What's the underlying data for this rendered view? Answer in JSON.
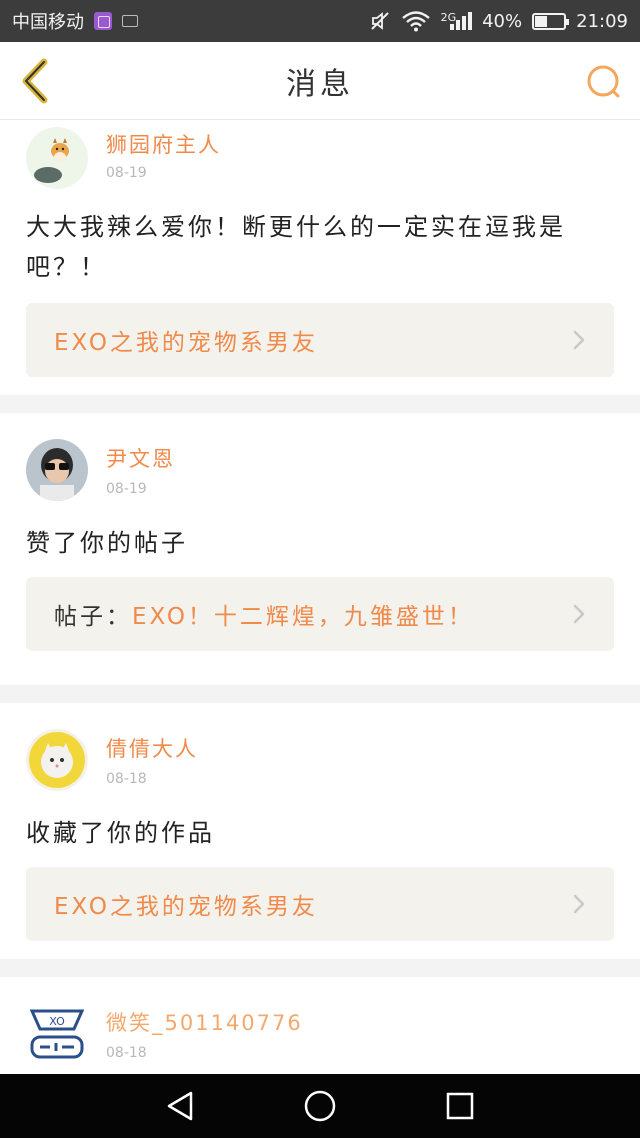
{
  "statusbar": {
    "carrier": "中国移动",
    "network": "2G",
    "battery": "40%",
    "battery_level": 0.4,
    "time": "21:09"
  },
  "header": {
    "title": "消息",
    "back_icon": "back-chevron-icon",
    "search_icon": "search-icon"
  },
  "messages": [
    {
      "username": "狮园府主人",
      "date": "08-19",
      "text": "大大我辣么爱你！断更什么的一定实在逗我是吧？！",
      "link_prefix": "",
      "link_text": "EXO之我的宠物系男友"
    },
    {
      "username": "尹文恩",
      "date": "08-19",
      "text": "赞了你的帖子",
      "link_prefix": "帖子：",
      "link_text": "EXO！十二辉煌，九雏盛世！"
    },
    {
      "username": "倩倩大人",
      "date": "08-18",
      "text": "收藏了你的作品",
      "link_prefix": "",
      "link_text": "EXO之我的宠物系男友"
    },
    {
      "username": "微笑_501140776",
      "date": "08-18"
    }
  ],
  "colors": {
    "accent": "#f08a4a",
    "statusbar_bg": "#3c3c3c",
    "link_box_bg": "#f3f2ec"
  }
}
